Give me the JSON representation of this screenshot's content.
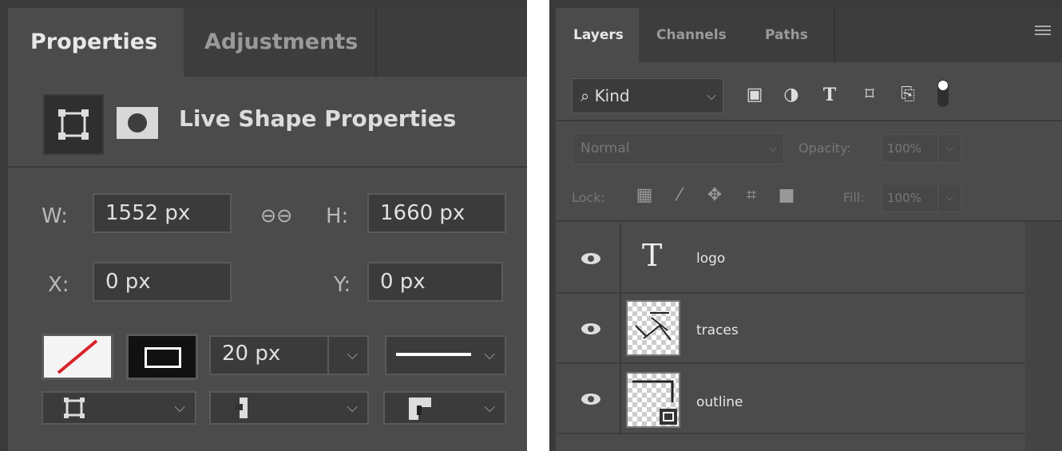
{
  "properties_panel": {
    "tabs": [
      "Properties",
      "Adjustments"
    ],
    "title": "Live Shape Properties",
    "w_label": "W:",
    "w_value": "1552 px",
    "h_label": "H:",
    "h_value": "1660 px",
    "x_label": "X:",
    "x_value": "0 px",
    "y_label": "Y:",
    "y_value": "0 px",
    "stroke_width": "20 px",
    "link_icon": "link-icon"
  },
  "layers_panel": {
    "tabs": [
      "Layers",
      "Channels",
      "Paths"
    ],
    "filter": "Kind",
    "blend_mode": "Normal",
    "opacity_label": "Opacity:",
    "opacity_value": "100%",
    "lock_label": "Lock:",
    "fill_label": "Fill:",
    "fill_value": "100%",
    "layers": [
      {
        "name": "logo",
        "kind": "text"
      },
      {
        "name": "traces",
        "kind": "image"
      },
      {
        "name": "outline",
        "kind": "shape"
      }
    ]
  },
  "colors": {
    "panel_bg": "#4b4b4b",
    "tab_bg": "#3d3d3d",
    "field_bg": "#3b3b3b"
  }
}
